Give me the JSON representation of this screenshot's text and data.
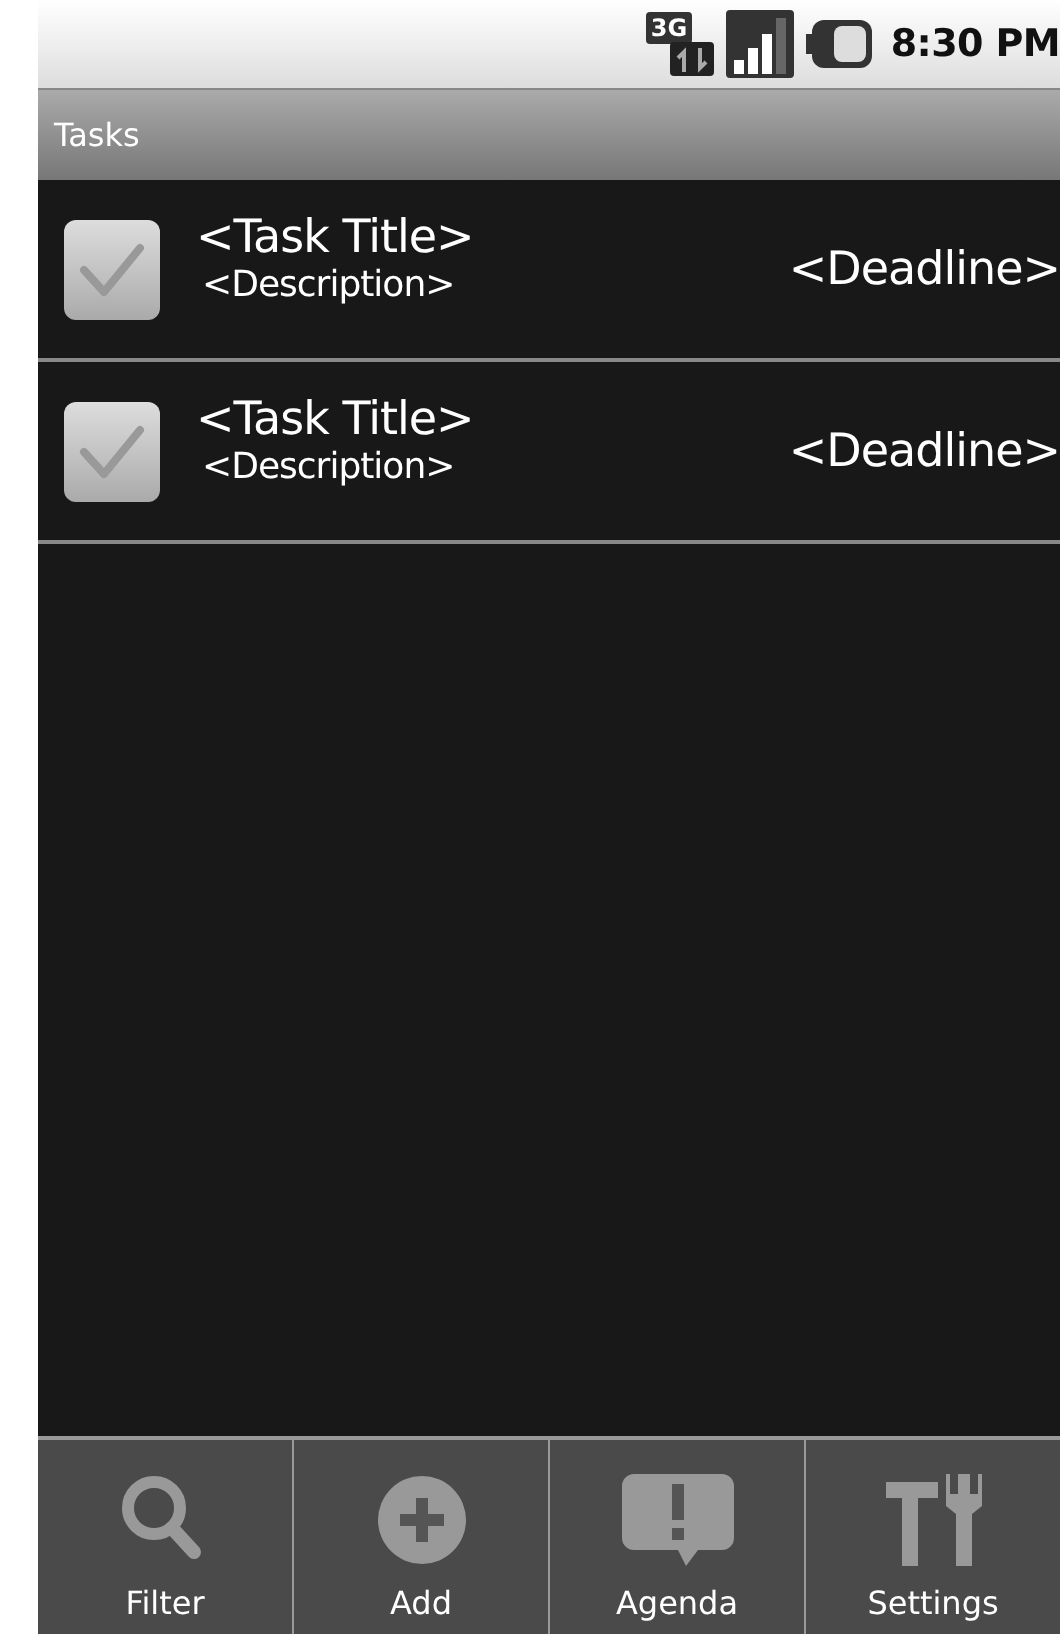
{
  "status_bar": {
    "network": "3G",
    "time": "8:30 PM"
  },
  "title_bar": {
    "title": "Tasks"
  },
  "tasks": [
    {
      "title": "<Task Title>",
      "description": "<Description>",
      "deadline": "<Deadline>",
      "checked": true
    },
    {
      "title": "<Task Title>",
      "description": "<Description>",
      "deadline": "<Deadline>",
      "checked": true
    }
  ],
  "menu": [
    {
      "label": "Filter",
      "kind": "search"
    },
    {
      "label": "Add",
      "kind": "add"
    },
    {
      "label": "Agenda",
      "kind": "alert"
    },
    {
      "label": "Settings",
      "kind": "tools"
    }
  ]
}
